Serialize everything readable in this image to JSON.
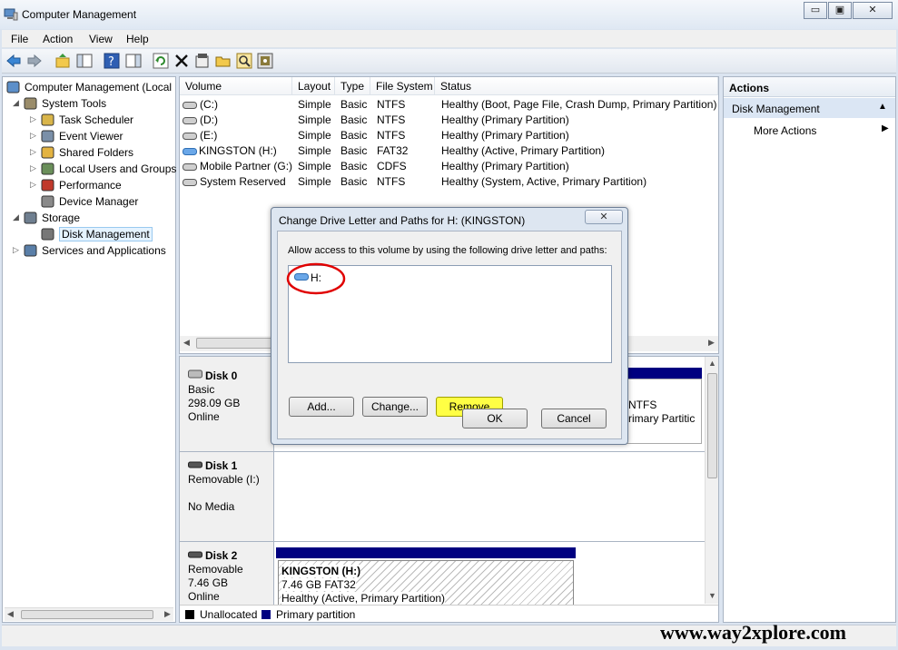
{
  "window": {
    "title": "Computer Management",
    "minimize": "▭",
    "restore": "▣",
    "close": "✕"
  },
  "menu": [
    "File",
    "Action",
    "View",
    "Help"
  ],
  "tree": [
    {
      "label": "Computer Management (Local",
      "expander": "",
      "level": 0,
      "icon": "computer-icon"
    },
    {
      "label": "System Tools",
      "expander": "◢",
      "level": 1,
      "icon": "tools-icon"
    },
    {
      "label": "Task Scheduler",
      "expander": "▷",
      "level": 2,
      "icon": "clock-icon"
    },
    {
      "label": "Event Viewer",
      "expander": "▷",
      "level": 2,
      "icon": "event-viewer-icon"
    },
    {
      "label": "Shared Folders",
      "expander": "▷",
      "level": 2,
      "icon": "shared-folder-icon"
    },
    {
      "label": "Local Users and Groups",
      "expander": "▷",
      "level": 2,
      "icon": "users-icon"
    },
    {
      "label": "Performance",
      "expander": "▷",
      "level": 2,
      "icon": "performance-icon"
    },
    {
      "label": "Device Manager",
      "expander": "",
      "level": 2,
      "icon": "device-manager-icon"
    },
    {
      "label": "Storage",
      "expander": "◢",
      "level": 1,
      "icon": "storage-icon"
    },
    {
      "label": "Disk Management",
      "expander": "",
      "level": 2,
      "icon": "disk-icon",
      "selected": true
    },
    {
      "label": "Services and Applications",
      "expander": "▷",
      "level": 1,
      "icon": "services-icon"
    }
  ],
  "volume_table": {
    "headers": [
      "Volume",
      "Layout",
      "Type",
      "File System",
      "Status"
    ],
    "rows": [
      [
        "(C:)",
        "Simple",
        "Basic",
        "NTFS",
        "Healthy (Boot, Page File, Crash Dump, Primary Partition)"
      ],
      [
        "(D:)",
        "Simple",
        "Basic",
        "NTFS",
        "Healthy (Primary Partition)"
      ],
      [
        "(E:)",
        "Simple",
        "Basic",
        "NTFS",
        "Healthy (Primary Partition)"
      ],
      [
        "KINGSTON (H:)",
        "Simple",
        "Basic",
        "FAT32",
        "Healthy (Active, Primary Partition)"
      ],
      [
        "Mobile Partner (G:)",
        "Simple",
        "Basic",
        "CDFS",
        "Healthy (Primary Partition)"
      ],
      [
        "System Reserved",
        "Simple",
        "Basic",
        "NTFS",
        "Healthy (System, Active, Primary Partition)"
      ]
    ]
  },
  "disks": [
    {
      "name": "Disk 0",
      "type": "Basic",
      "size": "298.09 GB",
      "state": "Online",
      "part_fs": "NTFS",
      "part_status": "rimary Partitic"
    },
    {
      "name": "Disk 1",
      "type": "Removable (I:)",
      "size": "",
      "state": "No Media"
    },
    {
      "name": "Disk 2",
      "type": "Removable",
      "size": "7.46 GB",
      "state": "Online",
      "part_name": "KINGSTON  (H:)",
      "part_size": "7.46 GB FAT32",
      "part_status": "Healthy (Active, Primary Partition)"
    }
  ],
  "legend": {
    "unallocated": "Unallocated",
    "primary": "Primary partition"
  },
  "actions": {
    "header": "Actions",
    "section": "Disk Management",
    "more": "More Actions"
  },
  "dialog": {
    "title": "Change Drive Letter and Paths for H: (KINGSTON)",
    "close": "✕",
    "instruction": "Allow access to this volume by using the following drive letter and paths:",
    "paths": [
      "H:"
    ],
    "add": "Add...",
    "change": "Change...",
    "remove": "Remove",
    "ok": "OK",
    "cancel": "Cancel"
  },
  "watermark": "www.way2xplore.com",
  "colors": {
    "primary_partition": "#000080",
    "highlight": "#ffff44",
    "annotation": "#e00000"
  }
}
